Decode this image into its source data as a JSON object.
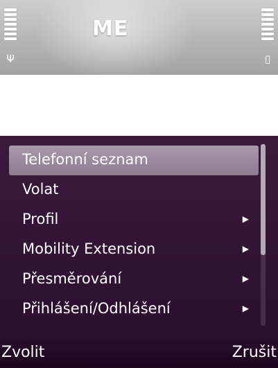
{
  "status_bar": {
    "title": "ME",
    "signal_icon": "antenna-icon",
    "battery_icon": "battery-icon",
    "signal_glyph": "Ψ",
    "battery_glyph": "▯"
  },
  "menu": {
    "items": [
      {
        "label": "Telefonní seznam",
        "highlighted": true,
        "submenu": false
      },
      {
        "label": "Volat",
        "highlighted": false,
        "submenu": false
      },
      {
        "label": "Profil",
        "highlighted": false,
        "submenu": true
      },
      {
        "label": "Mobility Extension",
        "highlighted": false,
        "submenu": true
      },
      {
        "label": "Přesměrování",
        "highlighted": false,
        "submenu": true
      },
      {
        "label": "Přihlášení/Odhlášení",
        "highlighted": false,
        "submenu": true
      }
    ],
    "submenu_glyph": "▶"
  },
  "softkeys": {
    "left": "Zvolit",
    "right": "Zrušit"
  },
  "colors": {
    "menu_background": "#2c0f2f",
    "highlight": "#9a8a9d",
    "text": "#ffffff"
  }
}
